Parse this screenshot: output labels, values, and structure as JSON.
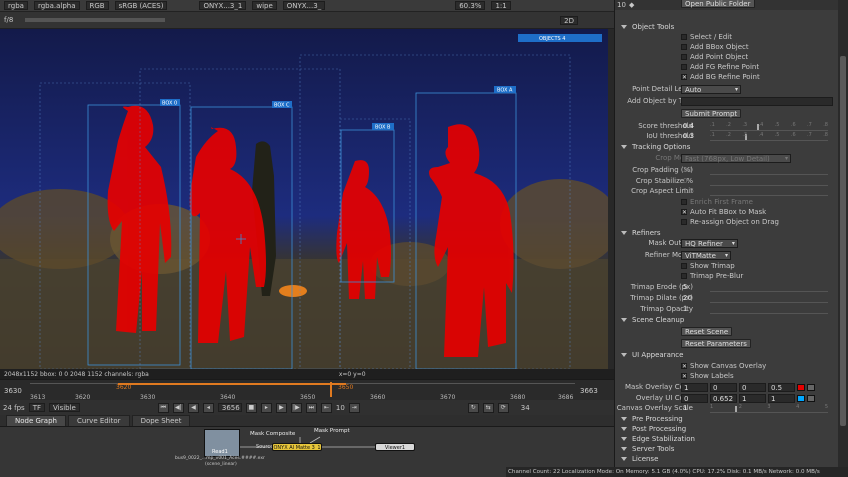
{
  "topbar": {
    "layer": "rgba",
    "channel": "rgba.alpha",
    "colorspace": "RGB",
    "display": "sRGB (ACES)",
    "input_a": "ONYX...3_1",
    "wipe": "wipe",
    "input_b": "ONYX...3_",
    "zoom": "60.3%",
    "ratio": "1:1"
  },
  "toolbar2": {
    "fstop": "f/8",
    "view_mode": "2D"
  },
  "viewer": {
    "labels": [
      "OBJECTS 4",
      "BOX 0",
      "BOX C",
      "BOX B",
      "BOX A"
    ],
    "colors": {
      "mask": "#e60000",
      "box": "#3b8fd6",
      "tag": "#1e6ec8"
    }
  },
  "infobar": {
    "left": "2048x1152  bbox: 0 0 2048 1152 channels: rgba",
    "coords": "x=0 y=0"
  },
  "timeline": {
    "start": "3630",
    "end": "3663",
    "ticks": [
      "3613",
      "3620",
      "3630",
      "3640",
      "3650",
      "3660",
      "3670",
      "3680",
      "3686"
    ],
    "marker_in": "3620",
    "marker_out": "3650"
  },
  "transport": {
    "fps": "24 fps",
    "tf": "TF",
    "visible": "Visible",
    "frame": "3656",
    "step": "10",
    "end_frame": "34"
  },
  "tabs": [
    "Node Graph",
    "Curve Editor",
    "Dope Sheet"
  ],
  "nodegraph": {
    "read": "Read1",
    "read_file": "bus9_0022_...mp_v001_Aces.####.exr",
    "read_cs": "(scene_linear)",
    "mask_comp": "Mask Composite",
    "mask_prompt": "Mask Prompt",
    "source": "Source",
    "onyx": "ONYX AI Matte 3_1",
    "viewer": "Viewer1"
  },
  "status": "Channel Count: 22  Localization Mode: On  Memory: 5.1 GB (4.0%)  CPU: 17.2%  Disk: 0.1 MB/s  Network: 0.0 MB/s",
  "panel": {
    "header_num": "10",
    "top_btn": "Open Public Folder",
    "object_tools": "Object Tools",
    "select_edit": "Select / Edit",
    "add_bbox": "Add BBox Object",
    "add_point": "Add Point Object",
    "add_fg": "Add FG Refine Point",
    "add_bg": "Add BG Refine Point",
    "point_detail_lbl": "Point Detail Level",
    "point_detail_val": "Auto",
    "add_by_text": "Add Object by Text",
    "submit": "Submit Prompt",
    "score_lbl": "Score threshold",
    "score_val": "0.4",
    "iou_lbl": "IoU threshold",
    "iou_val": "0.3",
    "tracking": "Tracking Options",
    "crop_mode_lbl": "Crop Mode",
    "crop_mode_val": "Fast (768px, Low Detail)",
    "crop_pad_lbl": "Crop Padding (%)",
    "crop_pad_val": "20",
    "crop_stab_lbl": "Crop Stabilize %",
    "crop_stab_val": "0",
    "crop_aspect_lbl": "Crop Aspect Limit",
    "crop_aspect_val": "1.5",
    "enrich": "Enrich First Frame",
    "autofit": "Auto Fit BBox to Mask",
    "reassign": "Re-assign Object on Drag",
    "refiners": "Refiners",
    "mask_out_lbl": "Mask Output",
    "mask_out_val": "HQ Refiner",
    "ref_model_lbl": "Refiner Model",
    "ref_model_val": "ViTMatte",
    "show_trimap": "Show Trimap",
    "trimap_pre": "Trimap Pre-Blur",
    "erode_lbl": "Trimap Erode (px)",
    "erode_val": "5",
    "dilate_lbl": "Trimap Dilate (px)",
    "dilate_val": "20",
    "opacity_lbl": "Trimap Opacity",
    "opacity_val": "1",
    "cleanup": "Scene Cleanup",
    "reset_scene": "Reset Scene",
    "reset_params": "Reset Parameters",
    "ui_appearance": "UI Appearance",
    "show_overlay": "Show Canvas Overlay",
    "show_labels": "Show Labels",
    "mask_color_lbl": "Mask Overlay Color",
    "mask_color_vals": [
      "1",
      "0",
      "0",
      "0.5"
    ],
    "ui_color_lbl": "Overlay UI Color",
    "ui_color_vals": [
      "0",
      "0.652",
      "1",
      "1"
    ],
    "canvas_scale_lbl": "Canvas Overlay Scale",
    "canvas_scale_val": "1",
    "pre": "Pre Processing",
    "post": "Post Processing",
    "edge": "Edge Stabilization",
    "server": "Server Tools",
    "license": "License",
    "slider_ticks": [
      "1",
      "2",
      "3",
      "4",
      "5"
    ],
    "slider_ticks_small": [
      ".1",
      ".2",
      ".3",
      ".4",
      ".5",
      ".6",
      ".7",
      ".8"
    ]
  }
}
